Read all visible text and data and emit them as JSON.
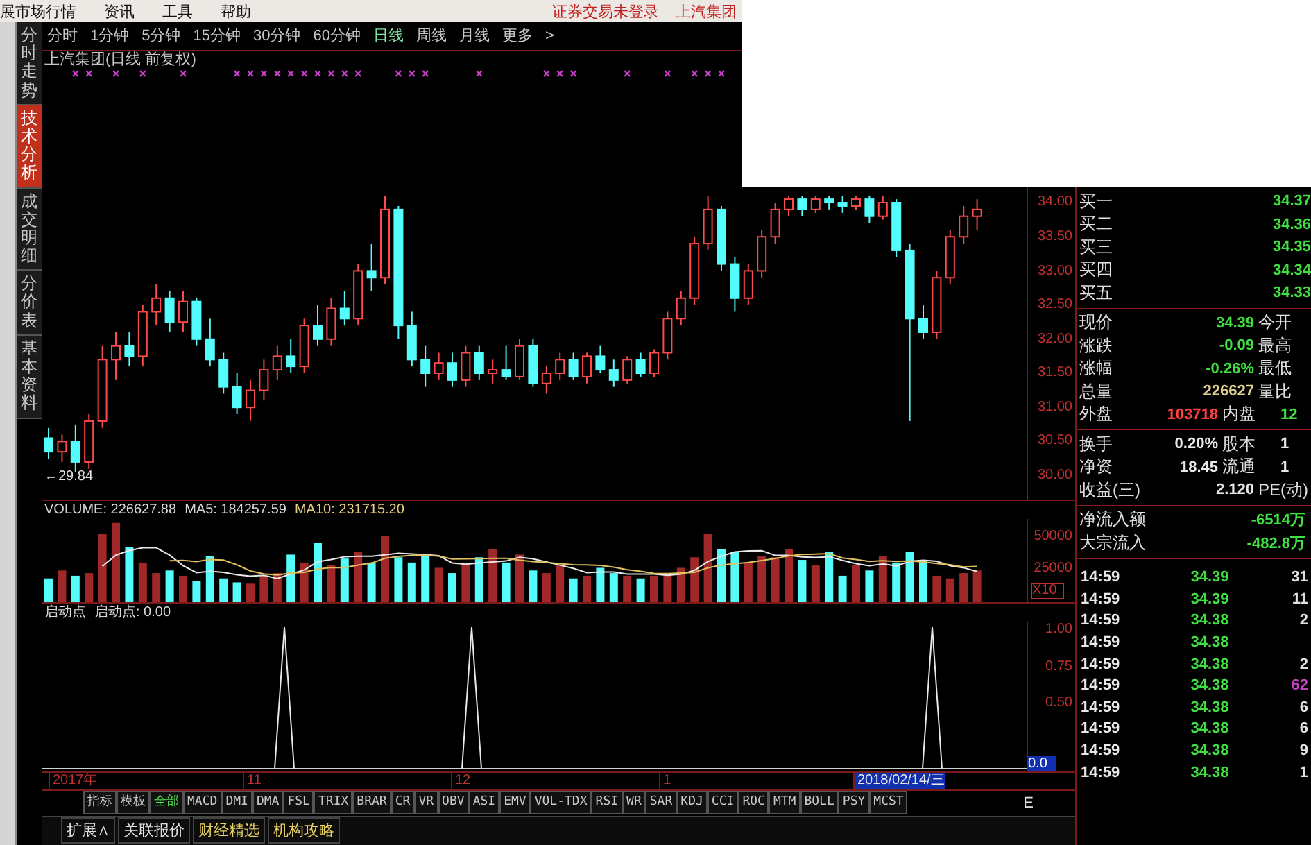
{
  "menu": {
    "items": [
      "展市场行情",
      "资讯",
      "工具",
      "帮助"
    ],
    "status": [
      "证券交易未登录",
      "上汽集团"
    ]
  },
  "side_tabs": [
    {
      "label": "分时走势",
      "selected": false
    },
    {
      "label": "技术分析",
      "selected": true
    },
    {
      "label": "成交明细",
      "selected": false
    },
    {
      "label": "分价表",
      "selected": false
    },
    {
      "label": "基本资料",
      "selected": false
    }
  ],
  "periods": [
    {
      "label": "分时",
      "selected": false
    },
    {
      "label": "1分钟",
      "selected": false
    },
    {
      "label": "5分钟",
      "selected": false
    },
    {
      "label": "15分钟",
      "selected": false
    },
    {
      "label": "30分钟",
      "selected": false
    },
    {
      "label": "60分钟",
      "selected": false
    },
    {
      "label": "日线",
      "selected": true
    },
    {
      "label": "周线",
      "selected": false
    },
    {
      "label": "月线",
      "selected": false
    },
    {
      "label": "更多",
      "selected": false
    }
  ],
  "more_arrow": ">",
  "chart": {
    "title": "上汽集团(日线 前复权)",
    "low_label": "←29.84",
    "chart_data": {
      "type": "candlestick",
      "ylim": [
        29.65,
        35.83
      ],
      "yticks": [
        {
          "value": 34,
          "label": "34.00"
        },
        {
          "value": 33.5,
          "label": "33.50"
        },
        {
          "value": 33,
          "label": "33.00"
        },
        {
          "value": 32.5,
          "label": "32.50"
        },
        {
          "value": 32,
          "label": "32.00"
        },
        {
          "value": 31.5,
          "label": "31.50"
        },
        {
          "value": 31,
          "label": "31.00"
        },
        {
          "value": 30.5,
          "label": "30.50"
        },
        {
          "value": 30,
          "label": "30.00"
        }
      ],
      "ohlc": [
        [
          30.55,
          30.7,
          30.25,
          30.35
        ],
        [
          30.35,
          30.6,
          30.2,
          30.5
        ],
        [
          30.5,
          30.75,
          30.05,
          30.2
        ],
        [
          30.2,
          30.9,
          30.1,
          30.8
        ],
        [
          30.8,
          31.9,
          30.7,
          31.7
        ],
        [
          31.7,
          32.1,
          31.4,
          31.9
        ],
        [
          31.9,
          32.1,
          31.6,
          31.75
        ],
        [
          31.75,
          32.5,
          31.6,
          32.4
        ],
        [
          32.4,
          32.8,
          32.2,
          32.6
        ],
        [
          32.6,
          32.7,
          32.1,
          32.25
        ],
        [
          32.25,
          32.7,
          32.1,
          32.55
        ],
        [
          32.55,
          32.6,
          31.9,
          32.0
        ],
        [
          32.0,
          32.3,
          31.6,
          31.7
        ],
        [
          31.7,
          31.8,
          31.2,
          31.3
        ],
        [
          31.3,
          31.5,
          30.9,
          31.0
        ],
        [
          31.0,
          31.4,
          30.8,
          31.25
        ],
        [
          31.25,
          31.7,
          31.1,
          31.55
        ],
        [
          31.55,
          31.9,
          31.4,
          31.75
        ],
        [
          31.75,
          32.0,
          31.5,
          31.6
        ],
        [
          31.6,
          32.3,
          31.5,
          32.2
        ],
        [
          32.2,
          32.5,
          31.9,
          32.0
        ],
        [
          32.0,
          32.6,
          31.9,
          32.45
        ],
        [
          32.45,
          32.7,
          32.2,
          32.3
        ],
        [
          32.3,
          33.1,
          32.2,
          33.0
        ],
        [
          33.0,
          33.4,
          32.7,
          32.9
        ],
        [
          32.9,
          34.1,
          32.8,
          33.9
        ],
        [
          33.9,
          33.95,
          32.0,
          32.2
        ],
        [
          32.2,
          32.4,
          31.6,
          31.7
        ],
        [
          31.7,
          31.9,
          31.3,
          31.5
        ],
        [
          31.5,
          31.8,
          31.4,
          31.65
        ],
        [
          31.65,
          31.8,
          31.3,
          31.4
        ],
        [
          31.4,
          31.9,
          31.3,
          31.8
        ],
        [
          31.8,
          31.9,
          31.4,
          31.5
        ],
        [
          31.5,
          31.7,
          31.35,
          31.55
        ],
        [
          31.55,
          31.9,
          31.4,
          31.45
        ],
        [
          31.45,
          32.0,
          31.4,
          31.9
        ],
        [
          31.9,
          32.0,
          31.3,
          31.35
        ],
        [
          31.35,
          31.6,
          31.2,
          31.5
        ],
        [
          31.5,
          31.8,
          31.4,
          31.7
        ],
        [
          31.7,
          31.8,
          31.4,
          31.45
        ],
        [
          31.45,
          31.8,
          31.35,
          31.75
        ],
        [
          31.75,
          31.9,
          31.5,
          31.55
        ],
        [
          31.55,
          31.7,
          31.3,
          31.4
        ],
        [
          31.4,
          31.75,
          31.35,
          31.7
        ],
        [
          31.7,
          31.8,
          31.45,
          31.5
        ],
        [
          31.5,
          31.85,
          31.45,
          31.8
        ],
        [
          31.8,
          32.4,
          31.7,
          32.3
        ],
        [
          32.3,
          32.7,
          32.2,
          32.6
        ],
        [
          32.6,
          33.5,
          32.5,
          33.4
        ],
        [
          33.4,
          34.1,
          33.3,
          33.9
        ],
        [
          33.9,
          33.95,
          33.0,
          33.1
        ],
        [
          33.1,
          33.2,
          32.4,
          32.6
        ],
        [
          32.6,
          33.1,
          32.5,
          33.0
        ],
        [
          33.0,
          33.6,
          32.9,
          33.5
        ],
        [
          33.5,
          34.0,
          33.4,
          33.9
        ],
        [
          33.9,
          34.1,
          33.8,
          34.05
        ],
        [
          34.05,
          34.1,
          33.8,
          33.9
        ],
        [
          33.9,
          34.1,
          33.85,
          34.05
        ],
        [
          34.05,
          34.1,
          33.9,
          34.0
        ],
        [
          34.0,
          34.1,
          33.85,
          33.95
        ],
        [
          33.95,
          34.1,
          33.9,
          34.05
        ],
        [
          34.05,
          34.1,
          33.7,
          33.8
        ],
        [
          33.8,
          34.1,
          33.75,
          34.0
        ],
        [
          34.0,
          34.05,
          33.2,
          33.3
        ],
        [
          33.3,
          33.4,
          30.8,
          32.3
        ],
        [
          32.3,
          32.5,
          32.0,
          32.1
        ],
        [
          32.1,
          33.0,
          32.0,
          32.9
        ],
        [
          32.9,
          33.6,
          32.8,
          33.5
        ],
        [
          33.5,
          33.95,
          33.4,
          33.8
        ],
        [
          33.8,
          34.05,
          33.6,
          33.9
        ]
      ]
    }
  },
  "volume": {
    "separator": ":",
    "readings": [
      "226627.88",
      "184257.59",
      "231715.20"
    ],
    "unit": "X10",
    "chart_data": {
      "type": "bar",
      "ylim": [
        0,
        63000
      ],
      "yticks": [
        {
          "value": 50000,
          "label": "50000"
        },
        {
          "value": 25000,
          "label": "25000"
        }
      ],
      "series": [
        {
          "name": "VOLUME",
          "type": "bar",
          "colors": [
            "#54fcfc",
            "#a02828",
            "#54fcfc",
            "#a02828",
            "#a02828",
            "#a02828",
            "#54fcfc",
            "#a02828",
            "#a02828",
            "#54fcfc",
            "#a02828",
            "#54fcfc",
            "#54fcfc",
            "#54fcfc",
            "#54fcfc",
            "#a02828",
            "#a02828",
            "#a02828",
            "#54fcfc",
            "#a02828",
            "#54fcfc",
            "#a02828",
            "#54fcfc",
            "#a02828",
            "#54fcfc",
            "#a02828",
            "#54fcfc",
            "#54fcfc",
            "#54fcfc",
            "#a02828",
            "#54fcfc",
            "#a02828",
            "#54fcfc",
            "#a02828",
            "#54fcfc",
            "#a02828",
            "#54fcfc",
            "#a02828",
            "#a02828",
            "#54fcfc",
            "#a02828",
            "#54fcfc",
            "#54fcfc",
            "#a02828",
            "#54fcfc",
            "#a02828",
            "#a02828",
            "#a02828",
            "#a02828",
            "#a02828",
            "#54fcfc",
            "#54fcfc",
            "#a02828",
            "#a02828",
            "#a02828",
            "#a02828",
            "#54fcfc",
            "#a02828",
            "#54fcfc",
            "#54fcfc",
            "#a02828",
            "#54fcfc",
            "#a02828",
            "#54fcfc",
            "#54fcfc",
            "#54fcfc",
            "#a02828",
            "#a02828",
            "#a02828",
            "#a02828"
          ],
          "values": [
            18000,
            24000,
            20000,
            22000,
            52000,
            60000,
            42000,
            30000,
            22000,
            24000,
            20000,
            16000,
            35000,
            18000,
            15000,
            14000,
            20000,
            22000,
            36000,
            30000,
            45000,
            28000,
            33000,
            38000,
            30000,
            50000,
            34000,
            30000,
            36000,
            26000,
            22000,
            30000,
            34000,
            40000,
            30000,
            36000,
            24000,
            22000,
            28000,
            18000,
            20000,
            26000,
            22000,
            20000,
            18000,
            20000,
            22000,
            26000,
            34000,
            52000,
            40000,
            38000,
            30000,
            35000,
            34000,
            40000,
            32000,
            28000,
            38000,
            20000,
            28000,
            24000,
            35000,
            30000,
            38000,
            32000,
            20000,
            18000,
            22000,
            24000
          ]
        },
        {
          "name": "MA5",
          "type": "line",
          "color": "#e8e8e8",
          "values": [
            null,
            null,
            null,
            null,
            27200,
            35600,
            39200,
            41200,
            41200,
            35600,
            27600,
            22400,
            23400,
            22600,
            20800,
            19600,
            20400,
            17800,
            21400,
            24400,
            30600,
            32200,
            34400,
            34800,
            34800,
            35800,
            37000,
            36400,
            36000,
            35200,
            29600,
            28800,
            29600,
            30400,
            31200,
            34000,
            32800,
            30400,
            28000,
            25600,
            22400,
            22800,
            22800,
            21200,
            21200,
            21200,
            20400,
            21200,
            24000,
            30800,
            34800,
            38000,
            38800,
            39000,
            35400,
            35400,
            34200,
            33800,
            34400,
            31600,
            29200,
            27600,
            29000,
            27400,
            31000,
            31800,
            31000,
            27600,
            26000,
            23200
          ]
        },
        {
          "name": "MA10",
          "type": "line",
          "color": "#e0c060",
          "values": [
            null,
            null,
            null,
            null,
            null,
            null,
            null,
            null,
            null,
            31400,
            31600,
            30800,
            32300,
            31900,
            28200,
            23600,
            21400,
            20600,
            22000,
            22600,
            25100,
            26300,
            26100,
            28100,
            29600,
            33200,
            34600,
            35400,
            35400,
            35000,
            32700,
            32900,
            33000,
            33200,
            33200,
            31800,
            30800,
            30000,
            29200,
            28400,
            28200,
            27800,
            26600,
            24600,
            23400,
            21800,
            21600,
            22000,
            22600,
            26000,
            28000,
            29200,
            30000,
            31500,
            33100,
            35100,
            36100,
            36300,
            36700,
            33500,
            32300,
            30900,
            31400,
            30900,
            31300,
            30500,
            29300,
            28300,
            26700,
            27100
          ]
        }
      ]
    }
  },
  "indicator": {
    "label": "启动点",
    "value": "启动点: 0.00",
    "axis": [
      "1.00",
      "0.75",
      "0.50"
    ],
    "cursor_value": "0.0"
  },
  "dates": [
    {
      "label": "2017年",
      "selected": false
    },
    {
      "label": "11",
      "selected": false
    },
    {
      "label": "12",
      "selected": false
    },
    {
      "label": "1",
      "selected": false
    },
    {
      "label": "2018/02/14/三",
      "selected": true
    }
  ],
  "indicator_tabs": [
    {
      "label": "指标",
      "selected": false
    },
    {
      "label": "模板",
      "selected": false
    },
    {
      "label": "全部",
      "selected": true
    },
    {
      "label": "MACD",
      "selected": false
    },
    {
      "label": "DMI",
      "selected": false
    },
    {
      "label": "DMA",
      "selected": false
    },
    {
      "label": "FSL",
      "selected": false
    },
    {
      "label": "TRIX",
      "selected": false
    },
    {
      "label": "BRAR",
      "selected": false
    },
    {
      "label": "CR",
      "selected": false
    },
    {
      "label": "VR",
      "selected": false
    },
    {
      "label": "OBV",
      "selected": false
    },
    {
      "label": "ASI",
      "selected": false
    },
    {
      "label": "EMV",
      "selected": false
    },
    {
      "label": "VOL-TDX",
      "selected": false
    },
    {
      "label": "RSI",
      "selected": false
    },
    {
      "label": "WR",
      "selected": false
    },
    {
      "label": "SAR",
      "selected": false
    },
    {
      "label": "KDJ",
      "selected": false
    },
    {
      "label": "CCI",
      "selected": false
    },
    {
      "label": "ROC",
      "selected": false
    },
    {
      "label": "MTM",
      "selected": false
    },
    {
      "label": "BOLL",
      "selected": false
    },
    {
      "label": "PSY",
      "selected": false
    },
    {
      "label": "MCST",
      "selected": false
    }
  ],
  "side_label": "E",
  "bottom_tabs": [
    {
      "label": "扩展∧",
      "color": "#e0e0e0"
    },
    {
      "label": "关联报价",
      "color": "#e0e0e0"
    },
    {
      "label": "财经精选",
      "color": "#e8d060"
    },
    {
      "label": "机构攻略",
      "color": "#e8d060"
    }
  ],
  "quote": {
    "bids": [
      {
        "label": "买一",
        "value": "34.37"
      },
      {
        "label": "买二",
        "value": "34.36"
      },
      {
        "label": "买三",
        "value": "34.35"
      },
      {
        "label": "买四",
        "value": "34.34"
      },
      {
        "label": "买五",
        "value": "34.33"
      }
    ],
    "stats": [
      {
        "label": "现价",
        "value": "34.39",
        "color": "#40e040",
        "label2": "今开"
      },
      {
        "label": "涨跌",
        "value": "-0.09",
        "color": "#40e040",
        "label2": "最高"
      },
      {
        "label": "涨幅",
        "value": "-0.26%",
        "color": "#40e040",
        "label2": "最低"
      },
      {
        "label": "总量",
        "value": "226627",
        "color": "#e0d090",
        "label2": "量比"
      },
      {
        "label": "外盘",
        "value": "103718",
        "color": "#ff4040",
        "label2": "内盘",
        "value2": {
          "text": "12",
          "color": "#40e040"
        }
      }
    ],
    "fund": [
      {
        "label": "换手",
        "value": "0.20%",
        "color": "#e8e8e8",
        "label2": "股本",
        "value2": {
          "text": "1",
          "color": "#e8e8e8"
        }
      },
      {
        "label": "净资",
        "value": "18.45",
        "color": "#e8e8e8",
        "label2": "流通",
        "value2": {
          "text": "1",
          "color": "#e8e8e8"
        }
      },
      {
        "label": "收益(三)",
        "value": "2.120",
        "color": "#e8e8e8",
        "label2": "PE(动)"
      }
    ],
    "flow": [
      {
        "label": "净流入额",
        "value": "-6514万",
        "color": "#40e040"
      },
      {
        "label": "大宗流入",
        "value": "-482.8万",
        "color": "#40e040"
      }
    ]
  },
  "ticks": [
    {
      "time": "14:59",
      "price": "34.39",
      "volume": "31",
      "color": "#e0e0e0"
    },
    {
      "time": "14:59",
      "price": "34.39",
      "volume": "11",
      "color": "#e0e0e0"
    },
    {
      "time": "14:59",
      "price": "34.38",
      "volume": "2",
      "color": "#e0e0e0"
    },
    {
      "time": "14:59",
      "price": "34.38"
    },
    {
      "time": "14:59",
      "price": "34.38",
      "volume": "2",
      "color": "#e0e0e0"
    },
    {
      "time": "14:59",
      "price": "34.38",
      "volume": "62",
      "color": "#c040c0"
    },
    {
      "time": "14:59",
      "price": "34.38",
      "volume": "6",
      "color": "#e0e0e0"
    },
    {
      "time": "14:59",
      "price": "34.38",
      "volume": "6",
      "color": "#e0e0e0"
    },
    {
      "time": "14:59",
      "price": "34.38",
      "volume": "9",
      "color": "#e0e0e0"
    },
    {
      "time": "14:59",
      "price": "34.38",
      "volume": "1",
      "color": "#e0e0e0"
    }
  ]
}
